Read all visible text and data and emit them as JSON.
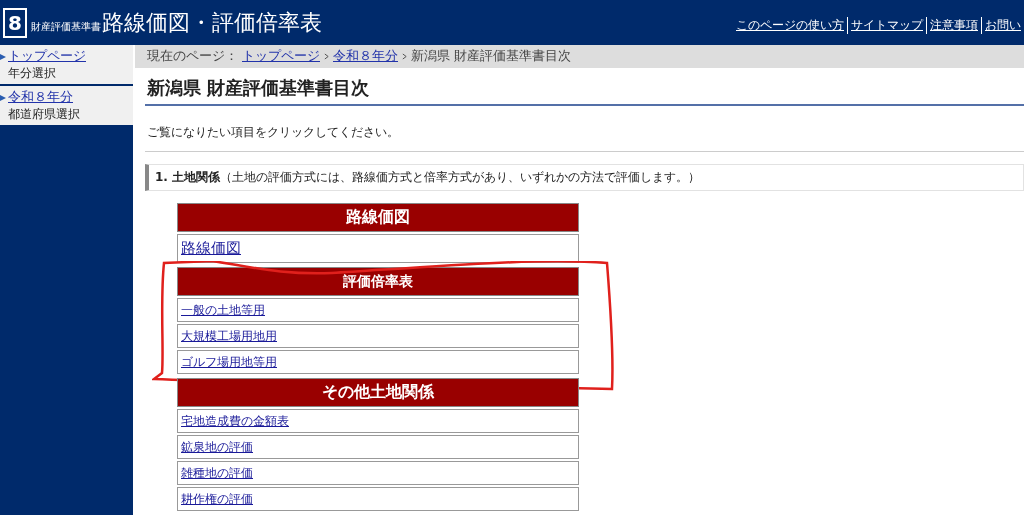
{
  "header": {
    "logo": "8",
    "subtitle": "財産評価基準書",
    "title": "路線価図・評価倍率表",
    "links": [
      "このページの使い方",
      "サイトマップ",
      "注意事項",
      "お問い"
    ]
  },
  "sidebar": {
    "items": [
      {
        "link": "トップページ",
        "caption": "年分選択"
      },
      {
        "link": "令和８年分",
        "caption": "都道府県選択"
      }
    ]
  },
  "breadcrumb": {
    "label": "現在のページ：",
    "links": [
      "トップページ",
      "令和８年分"
    ],
    "current": "新潟県 財産評価基準書目次"
  },
  "page_title": "新潟県 財産評価基準書目次",
  "intro": "ご覧になりたい項目をクリックしてください。",
  "section": {
    "number": "1.",
    "title": "土地関係",
    "note": "（土地の評価方式には、路線価方式と倍率方式があり、いずれかの方法で評価します。）"
  },
  "tables": [
    {
      "heading": "路線価図",
      "large": true,
      "annotated": false,
      "rows": [
        "路線価図"
      ]
    },
    {
      "heading": "評価倍率表",
      "large": false,
      "annotated": true,
      "rows": [
        "一般の土地等用",
        "大規模工場用地用",
        "ゴルフ場用地等用"
      ]
    },
    {
      "heading": "その他土地関係",
      "large": true,
      "annotated": false,
      "rows": [
        "宅地造成費の金額表",
        "鉱泉地の評価",
        "雑種地の評価",
        "耕作権の評価"
      ]
    }
  ]
}
